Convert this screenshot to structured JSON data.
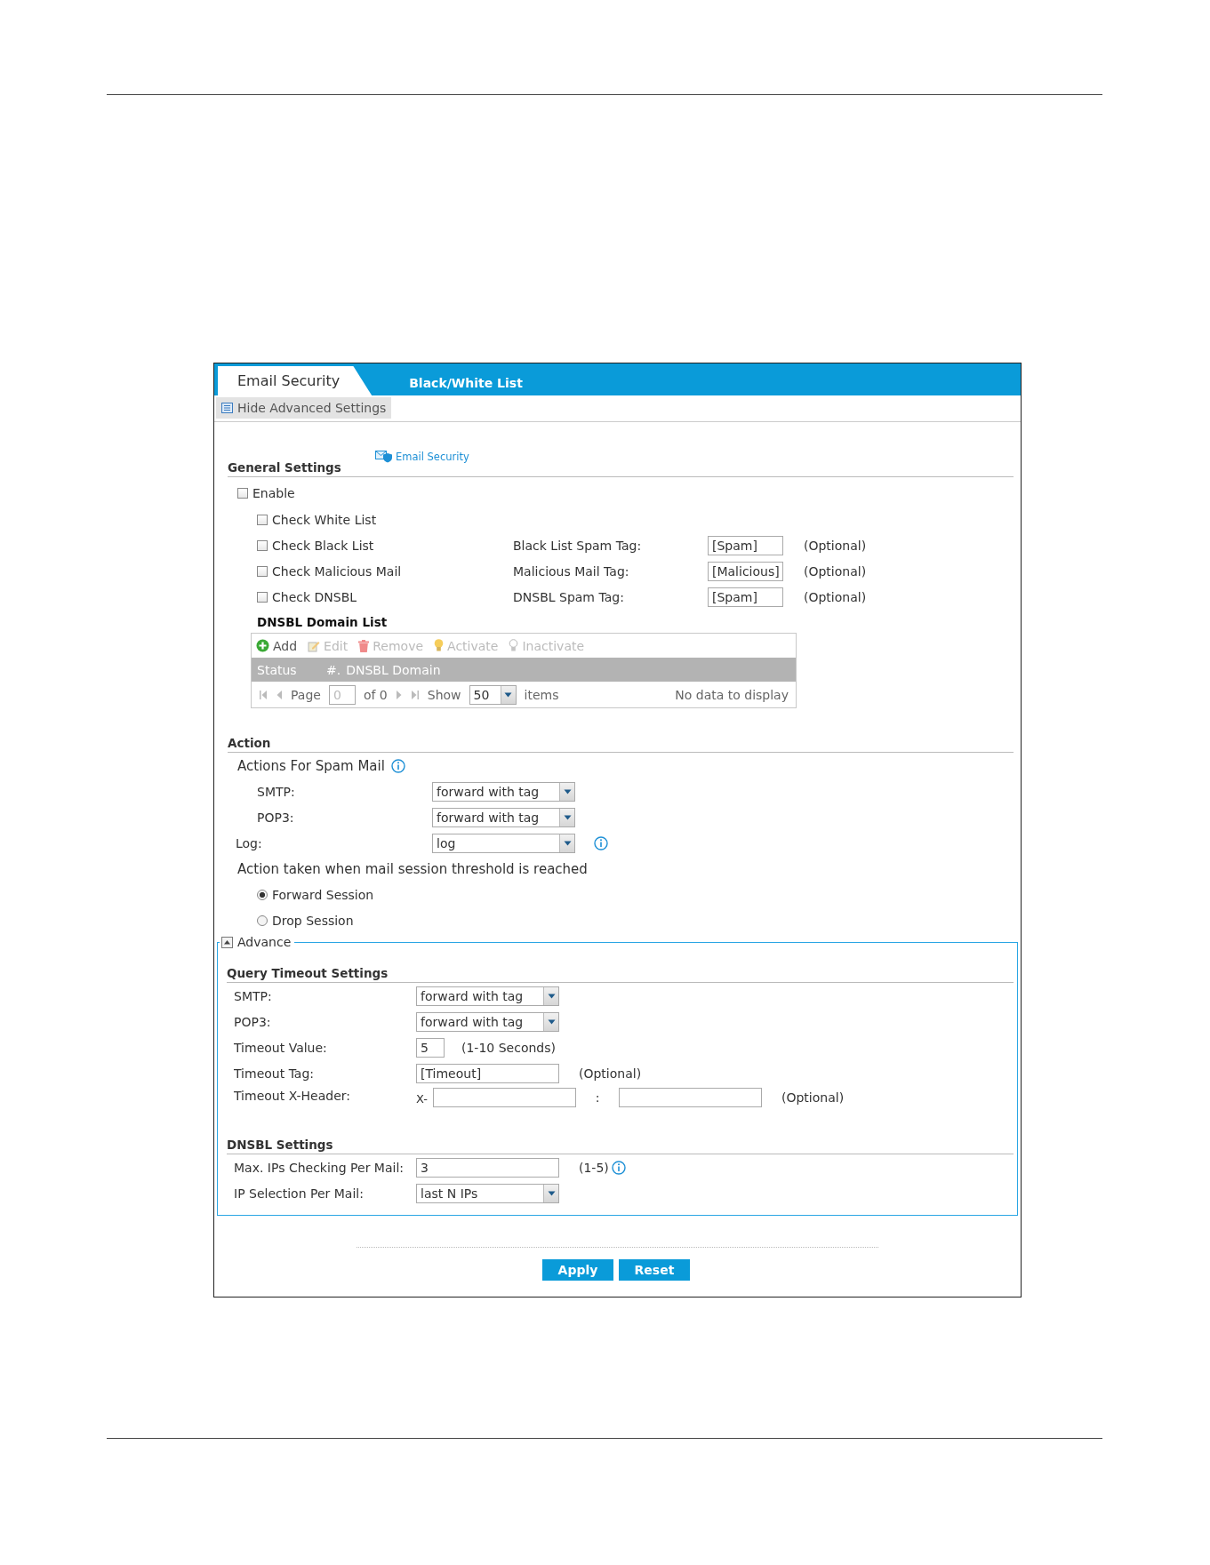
{
  "tabs": [
    {
      "label": "Email Security",
      "selected": true
    },
    {
      "label": "Black/White List",
      "selected": false
    }
  ],
  "advanced_toggle": "Hide Advanced Settings",
  "general": {
    "title": "General Settings",
    "link": "Email Security",
    "enable": {
      "label": "Enable",
      "checked": false
    },
    "checks": [
      {
        "label": "Check White List",
        "checked": false
      },
      {
        "label": "Check Black List",
        "checked": false,
        "tag_label": "Black List Spam Tag:",
        "tag_value": "[Spam]",
        "note": "(Optional)"
      },
      {
        "label": "Check Malicious Mail",
        "checked": false,
        "tag_label": "Malicious Mail Tag:",
        "tag_value": "[Malicious]",
        "note": "(Optional)"
      },
      {
        "label": "Check DNSBL",
        "checked": false,
        "tag_label": "DNSBL Spam Tag:",
        "tag_value": "[Spam]",
        "note": "(Optional)"
      }
    ]
  },
  "dnsbl_list": {
    "title": "DNSBL Domain List",
    "toolbar": [
      {
        "label": "Add",
        "kind": "add",
        "disabled": false
      },
      {
        "label": "Edit",
        "kind": "edit",
        "disabled": true
      },
      {
        "label": "Remove",
        "kind": "remove",
        "disabled": true
      },
      {
        "label": "Activate",
        "kind": "activate",
        "disabled": true
      },
      {
        "label": "Inactivate",
        "kind": "inactivate",
        "disabled": true
      }
    ],
    "columns": [
      "Status",
      "#.",
      "DNSBL Domain"
    ],
    "pager": {
      "page_label": "Page",
      "page_value": "0",
      "of": "of 0",
      "show": "Show",
      "per_page": "50",
      "items": "items",
      "empty": "No data to display"
    }
  },
  "action": {
    "title": "Action",
    "spam_title": "Actions For Spam Mail",
    "spam_rows": [
      {
        "label": "SMTP:",
        "value": "forward with tag"
      },
      {
        "label": "POP3:",
        "value": "forward with tag"
      }
    ],
    "log": {
      "label": "Log:",
      "value": "log"
    },
    "threshold_title": "Action taken when mail session threshold is reached",
    "threshold_options": [
      {
        "label": "Forward Session",
        "selected": true
      },
      {
        "label": "Drop Session",
        "selected": false
      }
    ]
  },
  "advance": {
    "legend": "Advance",
    "query": {
      "title": "Query Timeout Settings",
      "selects": [
        {
          "label": "SMTP:",
          "value": "forward with tag"
        },
        {
          "label": "POP3:",
          "value": "forward with tag"
        }
      ],
      "timeout_value": {
        "label": "Timeout Value:",
        "value": "5",
        "note": "(1-10 Seconds)"
      },
      "timeout_tag": {
        "label": "Timeout Tag:",
        "value": "[Timeout]",
        "note": "(Optional)"
      },
      "x_header": {
        "label": "Timeout X-Header:",
        "prefix": "X-",
        "separator": ":",
        "note": "(Optional)"
      }
    },
    "dnsbl": {
      "title": "DNSBL Settings",
      "max_ips": {
        "label": "Max. IPs Checking Per Mail:",
        "value": "3",
        "note": "(1-5)"
      },
      "ip_selection": {
        "label": "IP Selection Per Mail:",
        "value": "last N IPs"
      }
    }
  },
  "buttons": [
    "Apply",
    "Reset"
  ]
}
